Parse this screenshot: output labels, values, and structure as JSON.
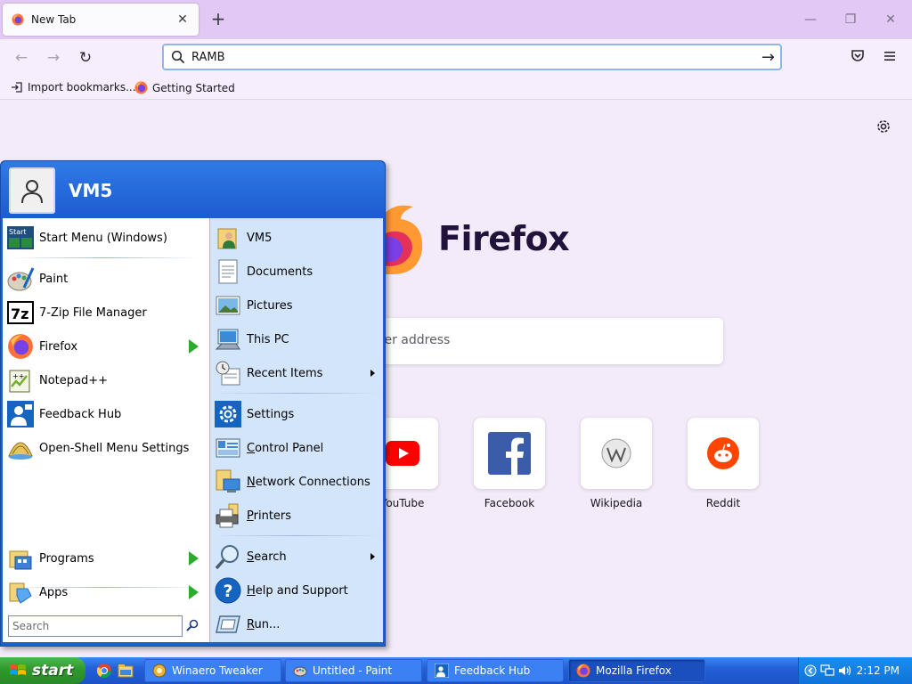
{
  "browser": {
    "tab_title": "New Tab",
    "tab_close": "✕",
    "new_tab": "+",
    "window_controls": {
      "minimize": "—",
      "restore": "❐",
      "close": "✕"
    },
    "url_value": "RAMB",
    "bookmarks": [
      {
        "label": "Import bookmarks...",
        "icon": "import-icon"
      },
      {
        "label": "Getting Started",
        "icon": "firefox-icon"
      }
    ]
  },
  "newtab": {
    "brand": "Firefox",
    "search_placeholder": "ter address",
    "shortcuts": [
      {
        "label": "YouTube",
        "icon": "youtube-icon"
      },
      {
        "label": "Facebook",
        "icon": "facebook-icon"
      },
      {
        "label": "Wikipedia",
        "icon": "wikipedia-icon"
      },
      {
        "label": "Reddit",
        "icon": "reddit-icon"
      }
    ]
  },
  "start_menu": {
    "username": "VM5",
    "left_items": [
      {
        "label": "Start Menu (Windows)",
        "icon": "start-menu-icon"
      },
      {
        "label": "Paint",
        "icon": "paint-icon"
      },
      {
        "label": "7-Zip File Manager",
        "icon": "7zip-icon"
      },
      {
        "label": "Firefox",
        "icon": "firefox-icon",
        "has_submenu": true
      },
      {
        "label": "Notepad++",
        "icon": "notepadpp-icon"
      },
      {
        "label": "Feedback Hub",
        "icon": "feedback-hub-icon"
      },
      {
        "label": "Open-Shell Menu Settings",
        "icon": "open-shell-icon"
      }
    ],
    "bottom_items": [
      {
        "label": "Programs",
        "icon": "programs-icon",
        "has_submenu": true
      },
      {
        "label": "Apps",
        "icon": "apps-icon",
        "has_submenu": true
      }
    ],
    "search_placeholder": "Search",
    "right_items": [
      {
        "label": "VM5",
        "icon": "user-folder-icon"
      },
      {
        "label": "Documents",
        "icon": "documents-icon"
      },
      {
        "label": "Pictures",
        "icon": "pictures-icon"
      },
      {
        "label": "This PC",
        "icon": "this-pc-icon"
      },
      {
        "label": "Recent Items",
        "icon": "recent-items-icon",
        "has_submenu": true
      },
      {
        "label": "Settings",
        "icon": "settings-icon"
      },
      {
        "label": "Control Panel",
        "icon": "control-panel-icon"
      },
      {
        "label": "Network Connections",
        "icon": "network-icon"
      },
      {
        "label": "Printers",
        "icon": "printers-icon"
      },
      {
        "label": "Search",
        "icon": "search-icon",
        "has_submenu": true
      },
      {
        "label": "Help and Support",
        "icon": "help-icon"
      },
      {
        "label": "Run...",
        "icon": "run-icon"
      }
    ]
  },
  "taskbar": {
    "start_label": "start",
    "buttons": [
      {
        "label": "Winaero Tweaker",
        "icon": "winaero-icon"
      },
      {
        "label": "Untitled - Paint",
        "icon": "paint-icon"
      },
      {
        "label": "Feedback Hub",
        "icon": "feedback-hub-icon"
      },
      {
        "label": "Mozilla Firefox",
        "icon": "firefox-icon",
        "active": true
      }
    ],
    "clock": "2:12 PM"
  }
}
